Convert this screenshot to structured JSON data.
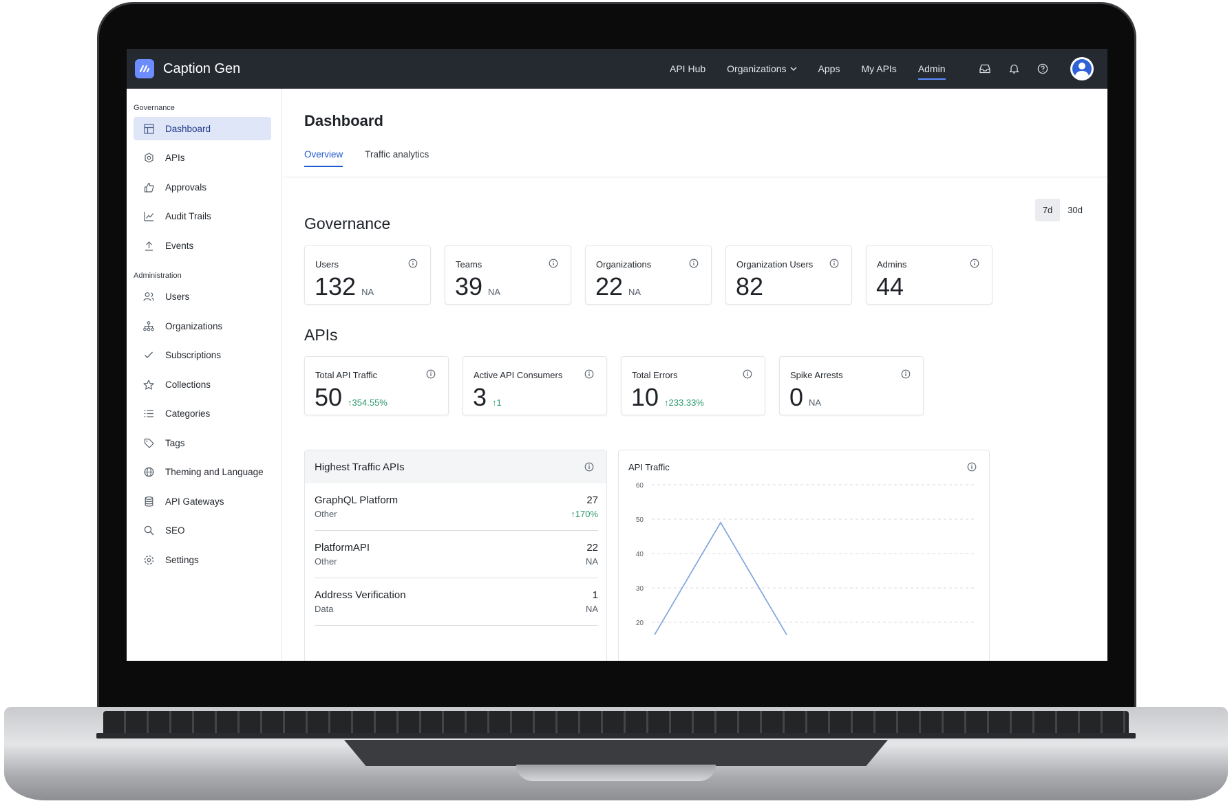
{
  "app": {
    "name": "Caption Gen"
  },
  "nav": {
    "items": [
      {
        "label": "API Hub",
        "active": false
      },
      {
        "label": "Organizations",
        "active": false,
        "dropdown": true
      },
      {
        "label": "Apps",
        "active": false
      },
      {
        "label": "My APIs",
        "active": false
      },
      {
        "label": "Admin",
        "active": true
      }
    ],
    "icons": [
      "inbox-icon",
      "bell-icon",
      "help-icon"
    ]
  },
  "sidebar": {
    "sections": [
      {
        "title": "Governance",
        "items": [
          {
            "label": "Dashboard",
            "icon": "dashboard-icon",
            "active": true
          },
          {
            "label": "APIs",
            "icon": "api-icon"
          },
          {
            "label": "Approvals",
            "icon": "thumbs-up-icon"
          },
          {
            "label": "Audit Trails",
            "icon": "chart-icon"
          },
          {
            "label": "Events",
            "icon": "upload-icon"
          }
        ]
      },
      {
        "title": "Administration",
        "items": [
          {
            "label": "Users",
            "icon": "users-icon"
          },
          {
            "label": "Organizations",
            "icon": "org-icon"
          },
          {
            "label": "Subscriptions",
            "icon": "check-icon"
          },
          {
            "label": "Collections",
            "icon": "star-icon"
          },
          {
            "label": "Categories",
            "icon": "list-icon"
          },
          {
            "label": "Tags",
            "icon": "tag-icon"
          },
          {
            "label": "Theming and Language",
            "icon": "globe-icon"
          },
          {
            "label": "API Gateways",
            "icon": "database-icon"
          },
          {
            "label": "SEO",
            "icon": "search-icon"
          },
          {
            "label": "Settings",
            "icon": "gear-icon"
          }
        ]
      }
    ]
  },
  "page": {
    "title": "Dashboard",
    "tabs": [
      {
        "label": "Overview",
        "active": true
      },
      {
        "label": "Traffic analytics",
        "active": false
      }
    ]
  },
  "governance": {
    "title": "Governance",
    "periods": [
      {
        "label": "7d",
        "active": true
      },
      {
        "label": "30d",
        "active": false
      }
    ],
    "cards": [
      {
        "label": "Users",
        "value": "132",
        "sub": "NA"
      },
      {
        "label": "Teams",
        "value": "39",
        "sub": "NA"
      },
      {
        "label": "Organizations",
        "value": "22",
        "sub": "NA"
      },
      {
        "label": "Organization Users",
        "value": "82",
        "sub": ""
      },
      {
        "label": "Admins",
        "value": "44",
        "sub": ""
      }
    ]
  },
  "apis": {
    "title": "APIs",
    "cards": [
      {
        "label": "Total API Traffic",
        "value": "50",
        "sub": "↑354.55%",
        "trend": "up"
      },
      {
        "label": "Active API Consumers",
        "value": "3",
        "sub": "↑1",
        "trend": "up"
      },
      {
        "label": "Total Errors",
        "value": "10",
        "sub": "↑233.33%",
        "trend": "up"
      },
      {
        "label": "Spike Arrests",
        "value": "0",
        "sub": "NA",
        "trend": "none"
      }
    ]
  },
  "highest_traffic": {
    "title": "Highest Traffic APIs",
    "rows": [
      {
        "name": "GraphQL Platform",
        "category": "Other",
        "value": "27",
        "change": "↑170%",
        "trend": "up"
      },
      {
        "name": "PlatformAPI",
        "category": "Other",
        "value": "22",
        "change": "NA",
        "trend": "none"
      },
      {
        "name": "Address Verification",
        "category": "Data",
        "value": "1",
        "change": "NA",
        "trend": "none"
      }
    ]
  },
  "traffic_chart": {
    "title": "API Traffic"
  },
  "chart_data": {
    "type": "line",
    "title": "API Traffic",
    "ylim": [
      20,
      60
    ],
    "yticks": [
      60,
      50,
      40,
      30,
      20
    ],
    "grid": true,
    "series": [
      {
        "x": [
          0,
          1,
          2
        ],
        "values": [
          15,
          49,
          15
        ]
      }
    ],
    "xlim": [
      0,
      4.7
    ],
    "colors": {
      "line": "#86a8e0"
    }
  },
  "colors": {
    "topbar": "#252a31",
    "accent": "#1f5bd0",
    "positive": "#2e9a6d"
  }
}
